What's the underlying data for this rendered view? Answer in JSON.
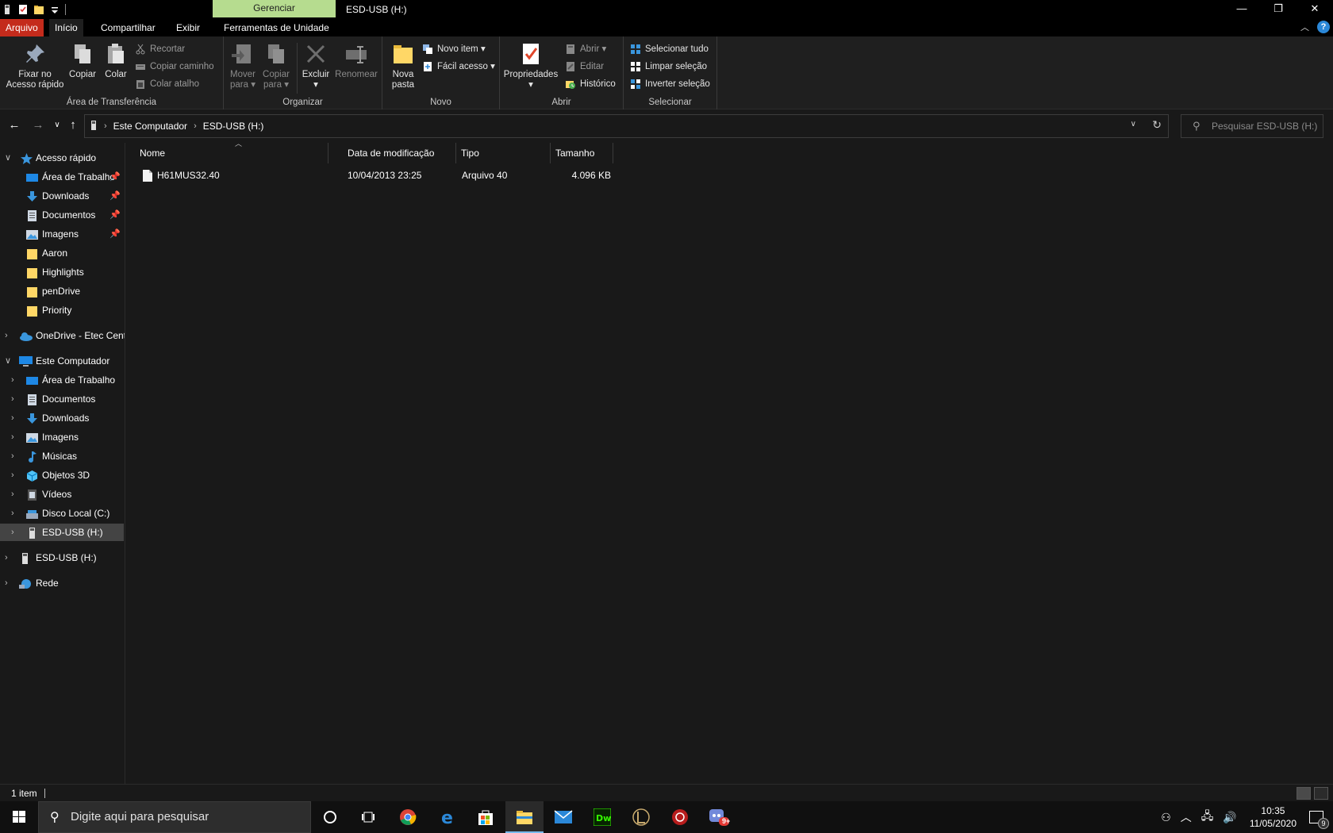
{
  "window": {
    "title": "ESD-USB (H:)",
    "contextual_tab": "Gerenciar",
    "controls": {
      "minimize": "—",
      "restore": "❐",
      "close": "✕"
    }
  },
  "ribbon_tabs": {
    "arquivo": "Arquivo",
    "inicio": "Início",
    "compartilhar": "Compartilhar",
    "exibir": "Exibir",
    "ferramentas": "Ferramentas de Unidade",
    "help": "?"
  },
  "ribbon": {
    "clipboard": {
      "label": "Área de Transferência",
      "pin_line1": "Fixar no",
      "pin_line2": "Acesso rápido",
      "copy": "Copiar",
      "paste": "Colar",
      "cut": "Recortar",
      "copy_path": "Copiar caminho",
      "paste_shortcut": "Colar atalho"
    },
    "organize": {
      "label": "Organizar",
      "move_line1": "Mover",
      "move_line2": "para ▾",
      "copyto_line1": "Copiar",
      "copyto_line2": "para ▾",
      "delete_line1": "Excluir",
      "delete_line2": "▾",
      "rename": "Renomear"
    },
    "new": {
      "label": "Novo",
      "folder_line1": "Nova",
      "folder_line2": "pasta",
      "new_item": "Novo item ▾",
      "easy_access": "Fácil acesso ▾"
    },
    "open": {
      "label": "Abrir",
      "properties": "Propriedades",
      "properties_caret": "▾",
      "open": "Abrir ▾",
      "edit": "Editar",
      "history": "Histórico"
    },
    "select": {
      "label": "Selecionar",
      "select_all": "Selecionar tudo",
      "select_none": "Limpar seleção",
      "invert": "Inverter seleção"
    }
  },
  "address": {
    "crumbs": [
      "Este Computador",
      "ESD-USB (H:)"
    ],
    "search_placeholder": "Pesquisar ESD-USB (H:)"
  },
  "navpane": {
    "quick_access": "Acesso rápido",
    "quick_items": [
      "Área de Trabalho",
      "Downloads",
      "Documentos",
      "Imagens",
      "Aaron",
      "Highlights",
      "penDrive",
      "Priority"
    ],
    "onedrive": "OneDrive - Etec Cent",
    "this_pc": "Este Computador",
    "pc_items": [
      "Área de Trabalho",
      "Documentos",
      "Downloads",
      "Imagens",
      "Músicas",
      "Objetos 3D",
      "Vídeos",
      "Disco Local (C:)",
      "ESD-USB (H:)"
    ],
    "usb": "ESD-USB (H:)",
    "network": "Rede"
  },
  "columns": {
    "name": "Nome",
    "modified": "Data de modificação",
    "type": "Tipo",
    "size": "Tamanho"
  },
  "files": [
    {
      "name": "H61MUS32.40",
      "modified": "10/04/2013 23:25",
      "type": "Arquivo 40",
      "size": "4.096 KB"
    }
  ],
  "status": {
    "count": "1 item"
  },
  "taskbar": {
    "search_placeholder": "Digite aqui para pesquisar",
    "time": "10:35",
    "date": "11/05/2020",
    "notifications": "9",
    "discord_badge": "9+"
  },
  "colors": {
    "accent_red": "#c42b1c",
    "contextual_green": "#b6dc8f",
    "background": "#191919",
    "taskbar": "#101010"
  }
}
